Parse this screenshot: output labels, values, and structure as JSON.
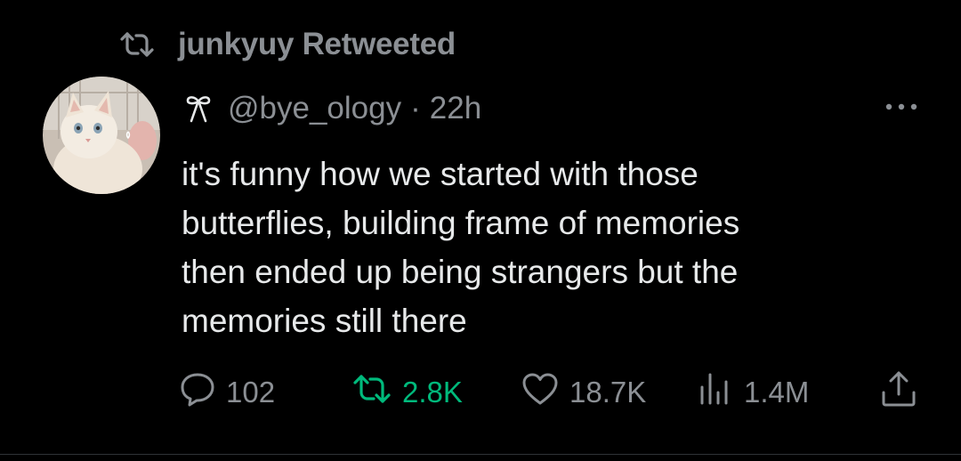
{
  "retweet_banner": {
    "icon": "retweet-icon",
    "text": "junkyuy Retweeted"
  },
  "tweet": {
    "avatar": "cat-avatar",
    "name_glyph": "bow-icon",
    "handle": "@bye_ology",
    "separator": "·",
    "time": "22h",
    "more_icon": "more-dots-icon",
    "text_lines": [
      "it's funny how we started with those",
      "butterflies, building frame of memories",
      "then ended up being strangers but the",
      "memories still there"
    ]
  },
  "actions": {
    "reply": {
      "icon": "reply-icon",
      "count": "102"
    },
    "retweet": {
      "icon": "retweet-icon",
      "count": "2.8K",
      "active_color": "#00ba7c"
    },
    "like": {
      "icon": "heart-icon",
      "count": "18.7K"
    },
    "views": {
      "icon": "views-icon",
      "count": "1.4M"
    },
    "share": {
      "icon": "share-icon"
    }
  },
  "colors": {
    "background": "#000000",
    "primary_text": "#e7e9ea",
    "secondary_text": "#8b8f94",
    "retweet_green": "#00ba7c"
  }
}
